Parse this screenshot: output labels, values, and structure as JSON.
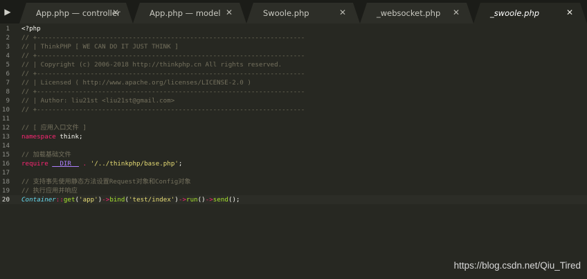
{
  "tabs": [
    {
      "label": "App.php — controller",
      "active": false
    },
    {
      "label": "App.php — model",
      "active": false
    },
    {
      "label": "Swoole.php",
      "active": false
    },
    {
      "label": "_websocket.php",
      "active": false
    },
    {
      "label": "_swoole.php",
      "active": true
    }
  ],
  "tab_close_glyph": "✕",
  "tab_scroll_glyph": "▶",
  "editor": {
    "current_line": 20,
    "lines": [
      {
        "n": "1",
        "segs": [
          {
            "t": "<?php",
            "c": "plain"
          }
        ]
      },
      {
        "n": "2",
        "segs": [
          {
            "t": "// +----------------------------------------------------------------------",
            "c": "comment"
          }
        ]
      },
      {
        "n": "3",
        "segs": [
          {
            "t": "// | ThinkPHP [ WE CAN DO IT JUST THINK ]",
            "c": "comment"
          }
        ]
      },
      {
        "n": "4",
        "segs": [
          {
            "t": "// +----------------------------------------------------------------------",
            "c": "comment"
          }
        ]
      },
      {
        "n": "5",
        "segs": [
          {
            "t": "// | Copyright (c) 2006-2018 http://thinkphp.cn All rights reserved.",
            "c": "comment"
          }
        ]
      },
      {
        "n": "6",
        "segs": [
          {
            "t": "// +----------------------------------------------------------------------",
            "c": "comment"
          }
        ]
      },
      {
        "n": "7",
        "segs": [
          {
            "t": "// | Licensed ( http://www.apache.org/licenses/LICENSE-2.0 )",
            "c": "comment"
          }
        ]
      },
      {
        "n": "8",
        "segs": [
          {
            "t": "// +----------------------------------------------------------------------",
            "c": "comment"
          }
        ]
      },
      {
        "n": "9",
        "segs": [
          {
            "t": "// | Author: liu21st <liu21st@gmail.com>",
            "c": "comment"
          }
        ]
      },
      {
        "n": "10",
        "segs": [
          {
            "t": "// +----------------------------------------------------------------------",
            "c": "comment"
          }
        ]
      },
      {
        "n": "11",
        "segs": []
      },
      {
        "n": "12",
        "segs": [
          {
            "t": "// [ 应用入口文件 ]",
            "c": "comment"
          }
        ]
      },
      {
        "n": "13",
        "segs": [
          {
            "t": "namespace",
            "c": "keyword"
          },
          {
            "t": " think;",
            "c": "plain"
          }
        ]
      },
      {
        "n": "14",
        "segs": []
      },
      {
        "n": "15",
        "segs": [
          {
            "t": "// 加载基础文件",
            "c": "comment"
          }
        ]
      },
      {
        "n": "16",
        "segs": [
          {
            "t": "require",
            "c": "keyword"
          },
          {
            "t": " ",
            "c": "plain"
          },
          {
            "t": "__DIR__",
            "c": "dunder"
          },
          {
            "t": " ",
            "c": "plain"
          },
          {
            "t": ".",
            "c": "keyword"
          },
          {
            "t": " ",
            "c": "plain"
          },
          {
            "t": "'/../thinkphp/base.php'",
            "c": "string"
          },
          {
            "t": ";",
            "c": "plain"
          }
        ]
      },
      {
        "n": "17",
        "segs": []
      },
      {
        "n": "18",
        "segs": [
          {
            "t": "// 支持事先使用静态方法设置Request对象和Config对象",
            "c": "comment"
          }
        ]
      },
      {
        "n": "19",
        "segs": [
          {
            "t": "// 执行应用并响应",
            "c": "comment"
          }
        ]
      },
      {
        "n": "20",
        "segs": [
          {
            "t": "Container",
            "c": "class"
          },
          {
            "t": "::",
            "c": "keyword"
          },
          {
            "t": "get",
            "c": "func"
          },
          {
            "t": "(",
            "c": "plain"
          },
          {
            "t": "'app'",
            "c": "string"
          },
          {
            "t": ")",
            "c": "plain"
          },
          {
            "t": "->",
            "c": "keyword"
          },
          {
            "t": "bind",
            "c": "func"
          },
          {
            "t": "(",
            "c": "plain"
          },
          {
            "t": "'test/index'",
            "c": "string"
          },
          {
            "t": ")",
            "c": "plain"
          },
          {
            "t": "->",
            "c": "keyword"
          },
          {
            "t": "run",
            "c": "func"
          },
          {
            "t": "()",
            "c": "plain"
          },
          {
            "t": "->",
            "c": "keyword"
          },
          {
            "t": "send",
            "c": "func"
          },
          {
            "t": "();",
            "c": "plain"
          }
        ]
      }
    ]
  },
  "watermark": "https://blog.csdn.net/Qiu_Tired",
  "colors": {
    "background": "#272822",
    "comment": "#75715e",
    "keyword": "#f92672",
    "string": "#e6db74",
    "class": "#66d9ef",
    "function": "#a6e22e",
    "constant": "#ae81ff"
  }
}
